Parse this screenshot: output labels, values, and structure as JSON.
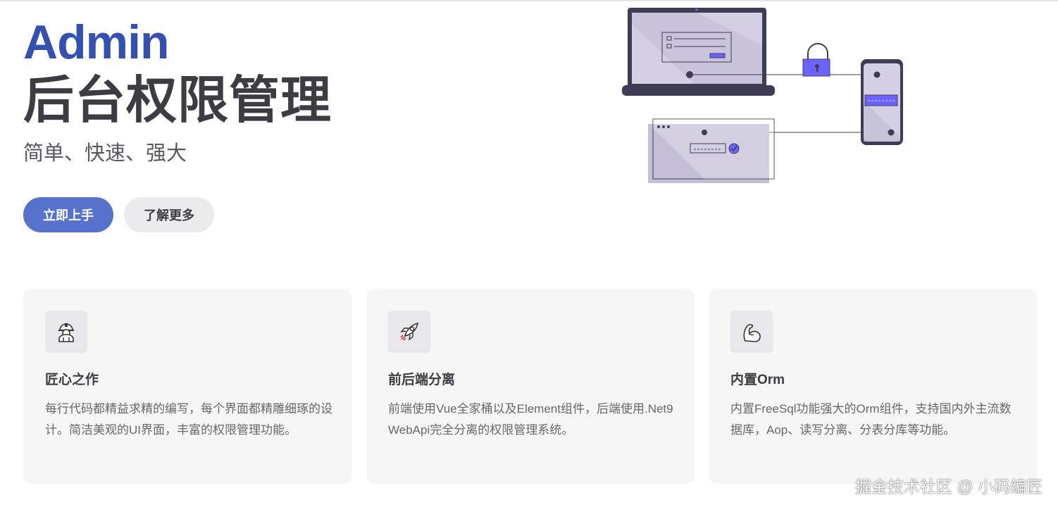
{
  "hero": {
    "name": "Admin",
    "text": "后台权限管理",
    "tagline": "简单、快速、强大"
  },
  "actions": {
    "primary": "立即上手",
    "secondary": "了解更多"
  },
  "features": [
    {
      "icon": "worker-icon",
      "title": "匠心之作",
      "details": "每行代码都精益求精的编写，每个界面都精雕细琢的设计。简洁美观的UI界面，丰富的权限管理功能。"
    },
    {
      "icon": "rocket-icon",
      "title": "前后端分离",
      "details": "前端使用Vue全家桶以及Element组件，后端使用.Net9 WebApi完全分离的权限管理系统。"
    },
    {
      "icon": "flexed-biceps-icon",
      "title": "内置Orm",
      "details": "内置FreeSql功能强大的Orm组件，支持国内外主流数据库，Aop、读写分离、分表分库等功能。"
    }
  ],
  "watermark": "掘金技术社区 @ 小码编匠",
  "colors": {
    "brand": "#3451b2",
    "button_brand": "#5672cd",
    "illustration_accent": "#6c63ff"
  }
}
